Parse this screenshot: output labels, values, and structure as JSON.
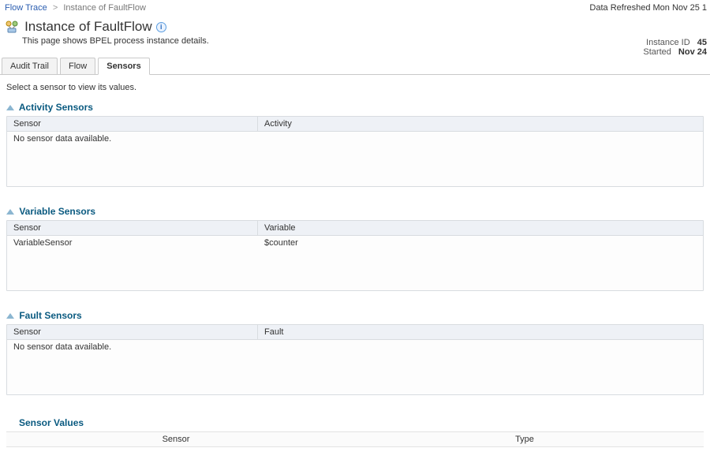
{
  "breadcrumb": {
    "root_label": "Flow Trace",
    "current_label": "Instance of FaultFlow"
  },
  "refreshed_label": "Data Refreshed Mon Nov 25 1",
  "title": "Instance of FaultFlow",
  "title_icon": "flow-instance-icon",
  "info_icon_glyph": "i",
  "subtitle": "This page shows BPEL process instance details.",
  "meta": {
    "instance_id_label": "Instance ID",
    "instance_id_value": "45",
    "started_label": "Started",
    "started_value": "Nov 24"
  },
  "tabs": [
    {
      "id": "audit",
      "label": "Audit Trail",
      "active": false
    },
    {
      "id": "flow",
      "label": "Flow",
      "active": false
    },
    {
      "id": "sensors",
      "label": "Sensors",
      "active": true
    }
  ],
  "hint": "Select a sensor to view its values.",
  "sections": {
    "activity": {
      "title": "Activity Sensors",
      "columns": [
        "Sensor",
        "Activity"
      ],
      "empty_text": "No sensor data available.",
      "rows": []
    },
    "variable": {
      "title": "Variable Sensors",
      "columns": [
        "Sensor",
        "Variable"
      ],
      "rows": [
        {
          "sensor": "VariableSensor",
          "value": "$counter"
        }
      ]
    },
    "fault": {
      "title": "Fault Sensors",
      "columns": [
        "Sensor",
        "Fault"
      ],
      "empty_text": "No sensor data available.",
      "rows": []
    }
  },
  "sensor_values": {
    "title": "Sensor Values",
    "columns": [
      "Sensor",
      "Type"
    ]
  }
}
